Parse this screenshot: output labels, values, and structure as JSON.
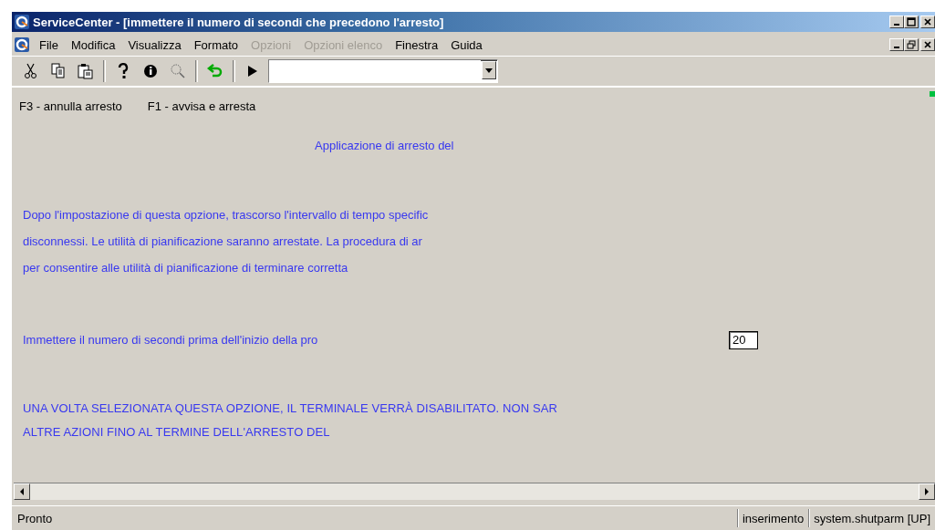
{
  "window": {
    "title": "ServiceCenter - [immettere il numero di secondi che precedono l'arresto]"
  },
  "menu": [
    {
      "label": "File",
      "disabled": false
    },
    {
      "label": "Modifica",
      "disabled": false
    },
    {
      "label": "Visualizza",
      "disabled": false
    },
    {
      "label": "Formato",
      "disabled": false
    },
    {
      "label": "Opzioni",
      "disabled": true
    },
    {
      "label": "Opzioni elenco",
      "disabled": true
    },
    {
      "label": "Finestra",
      "disabled": false
    },
    {
      "label": "Guida",
      "disabled": false
    }
  ],
  "function_keys": [
    "F3 - annulla arresto",
    "F1 - avvisa e arresta"
  ],
  "form": {
    "heading": "Applicazione di arresto del",
    "description": [
      "Dopo l'impostazione di questa opzione, trascorso l'intervallo di tempo specific",
      "disconnessi. Le utilità di pianificazione saranno arrestate. La procedura di ar",
      "per consentire alle utilità di pianificazione di terminare corretta"
    ],
    "seconds_label": "Immettere il numero di secondi prima dell'inizio della pro",
    "seconds_value": "20",
    "warning": [
      "UNA VOLTA SELEZIONATA QUESTA OPZIONE, IL TERMINALE VERRÀ DISABILITATO. NON SAR",
      "ALTRE AZIONI FINO AL TERMINE DELL'ARRESTO DEL"
    ]
  },
  "status_bar": {
    "message": "Pronto",
    "mode": "inserimento",
    "context": "system.shutparm [UP]"
  }
}
